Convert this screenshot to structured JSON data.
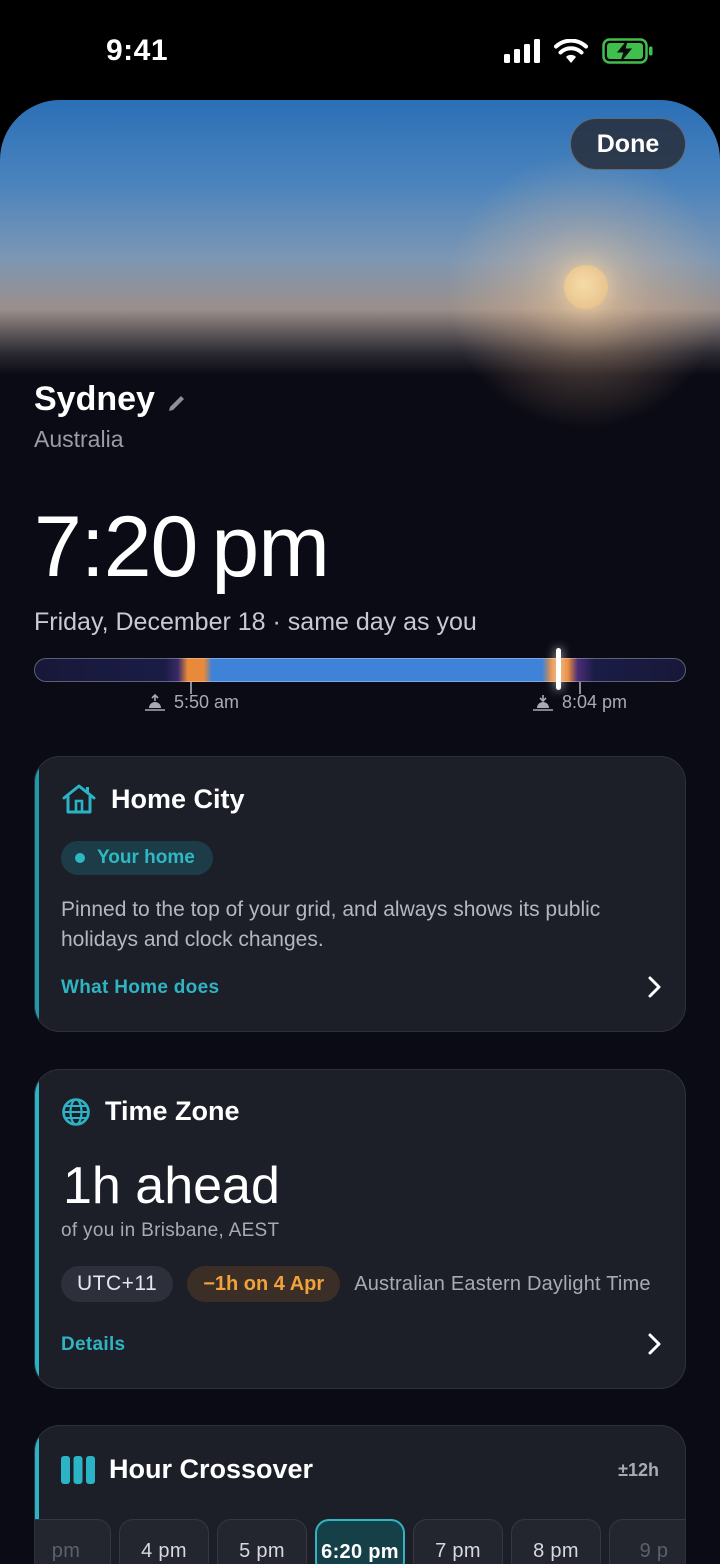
{
  "status_bar": {
    "time": "9:41"
  },
  "header": {
    "done_label": "Done"
  },
  "location": {
    "city": "Sydney",
    "country": "Australia"
  },
  "clock": {
    "time": "7:20",
    "meridiem": "pm",
    "date_line": "Friday, December 18 · same day as you"
  },
  "daylight": {
    "sunrise": "5:50 am",
    "sunset": "8:04 pm"
  },
  "home_card": {
    "title": "Home City",
    "badge": "Your home",
    "description": "Pinned to the top of your grid, and always shows its public holidays and clock changes.",
    "link": "What Home does"
  },
  "timezone_card": {
    "title": "Time Zone",
    "offset_text": "1h ahead",
    "subtitle": "of you in Brisbane, AEST",
    "utc_badge": "UTC+11",
    "dst_badge": "−1h on 4 Apr",
    "zone_name": "Australian Eastern Daylight Time",
    "link": "Details"
  },
  "hour_crossover": {
    "title": "Hour Crossover",
    "range": "±12h",
    "hours": [
      "pm",
      "4 pm",
      "5 pm",
      "6:20 pm",
      "7 pm",
      "8 pm",
      "9 p"
    ],
    "selected_index": 3
  },
  "colors": {
    "accent": "#2fb4c2",
    "dst": "#f0a23c",
    "card": "#1c1e28",
    "background": "#0b0b15"
  },
  "icons": [
    "signal-icon",
    "wifi-icon",
    "battery-charging-icon",
    "pencil-icon",
    "sunrise-icon",
    "sunset-icon",
    "house-icon",
    "globe-icon",
    "chevron-right-icon",
    "columns-icon"
  ]
}
